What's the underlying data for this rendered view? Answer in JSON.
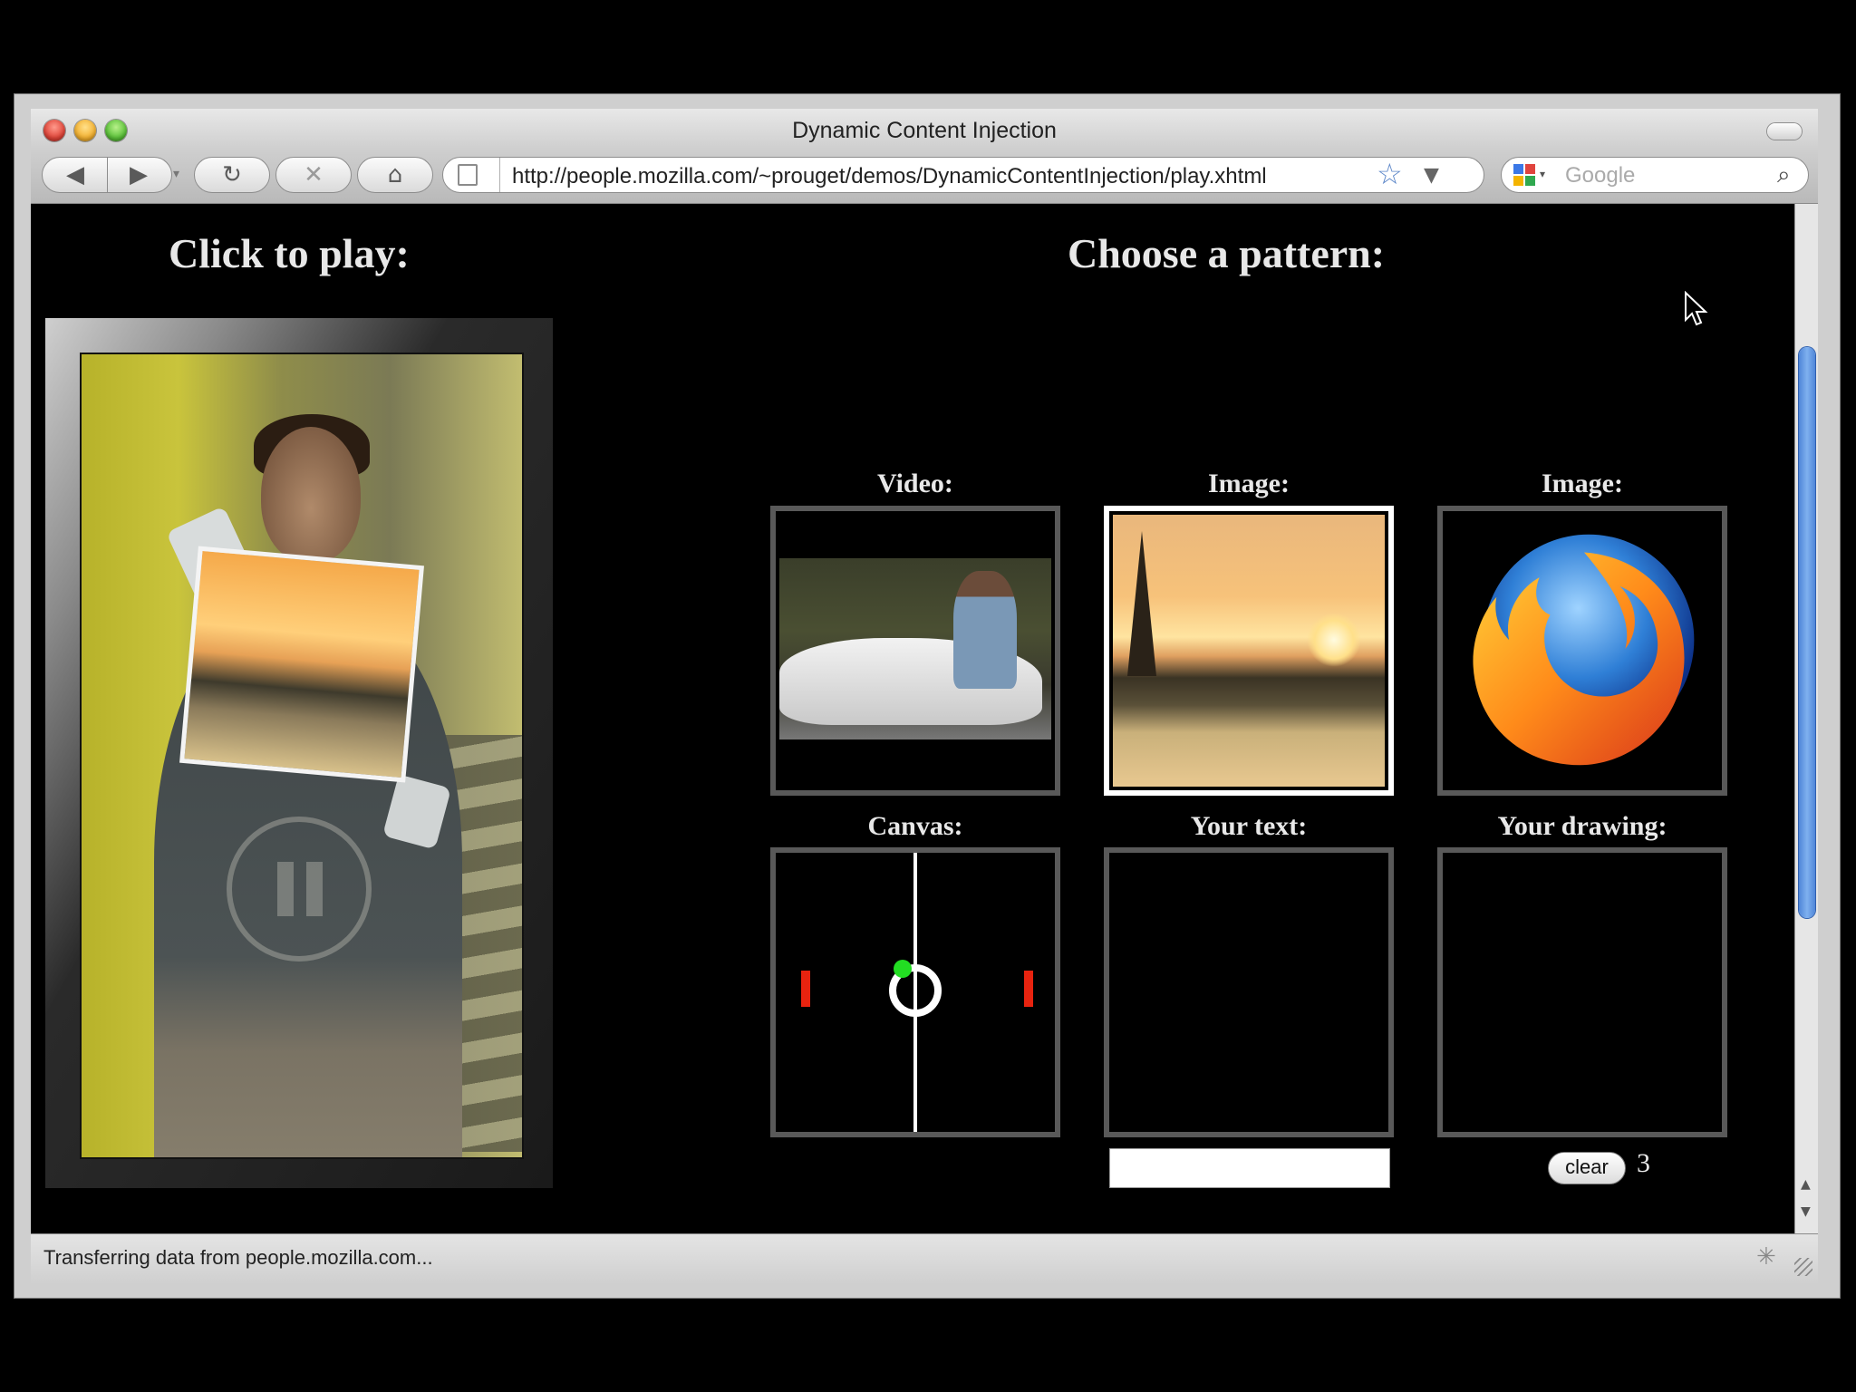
{
  "window": {
    "title": "Dynamic Content Injection"
  },
  "toolbar": {
    "back_icon": "◀",
    "forward_icon": "▶",
    "history_dropdown_icon": "▾",
    "reload_icon": "↻",
    "stop_icon": "✕",
    "home_icon": "⌂",
    "url": "http://people.mozilla.com/~prouget/demos/DynamicContentInjection/play.xhtml",
    "bookmark_star_icon": "☆",
    "url_dropdown_icon": "▼",
    "search_placeholder": "Google",
    "search_engine_arrow": "▾",
    "search_icon": "⌕"
  },
  "page": {
    "left_heading": "Click to play:",
    "right_heading": "Choose a pattern:",
    "patterns": {
      "video_label": "Video:",
      "image1_label": "Image:",
      "image2_label": "Image:",
      "canvas_label": "Canvas:",
      "text_label": "Your text:",
      "drawing_label": "Your drawing:"
    },
    "selected_pattern": "Image (Eiffel Tower)",
    "text_input_value": "",
    "clear_button": "clear",
    "brush_size": "3"
  },
  "scrollbar": {
    "up_icon": "▲",
    "down_icon": "▼"
  },
  "statusbar": {
    "text": "Transferring data from people.mozilla.com...",
    "activity_icon": "✳"
  },
  "colors": {
    "page_background": "#000000",
    "cell_border": "#595959",
    "selected_border": "#ffffff",
    "paddle": "#e8230f",
    "ball_marker": "#22dd22",
    "scroll_thumb": "#5f95e0"
  }
}
